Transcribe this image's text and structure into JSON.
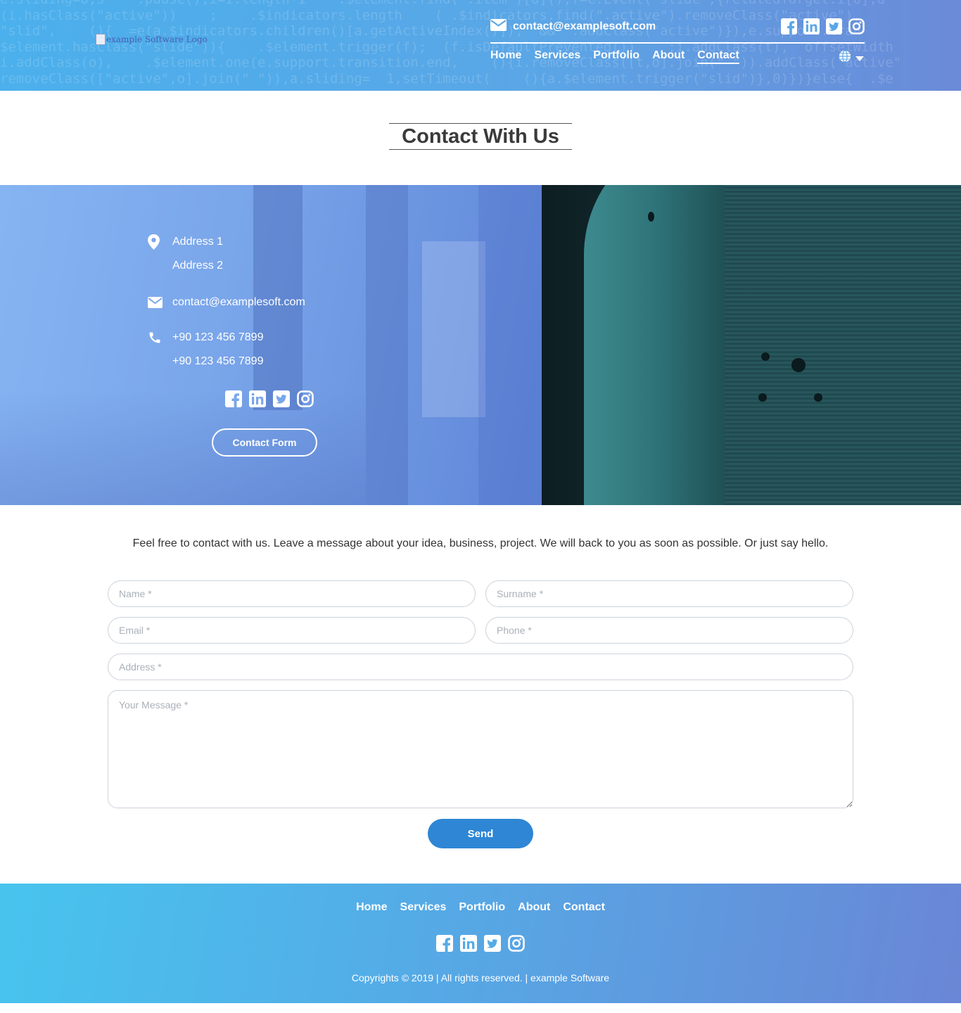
{
  "header": {
    "logo_alt": "example Software Logo",
    "email": "contact@examplesoft.com",
    "nav": [
      "Home",
      "Services",
      "Portfolio",
      "About",
      "Contact"
    ],
    "active_nav": "Contact",
    "social": [
      "facebook-icon",
      "linkedin-icon",
      "twitter-icon",
      "instagram-icon"
    ],
    "language_icon": "globe-icon"
  },
  "section": {
    "title": "Contact With Us"
  },
  "contact_info": {
    "address_line1": "Address 1",
    "address_line2": "Address 2",
    "email": "contact@examplesoft.com",
    "phone1": "+90 123 456 7899",
    "phone2": "+90 123 456 7899",
    "contact_form_button": "Contact Form"
  },
  "form": {
    "intro": "Feel free to contact with us. Leave a message about your idea, business, project. We will back to you as soon as possible. Or just say hello.",
    "name_placeholder": "Name *",
    "surname_placeholder": "Surname *",
    "email_placeholder": "Email *",
    "phone_placeholder": "Phone *",
    "address_placeholder": "Address *",
    "message_placeholder": "Your Message *",
    "send_label": "Send"
  },
  "footer": {
    "nav": [
      "Home",
      "Services",
      "Portfolio",
      "About",
      "Contact"
    ],
    "copyright": "Copyrights © 2019 | All rights reserved. | example Software"
  },
  "colors": {
    "header_gradient_start": "#4bb0ec",
    "header_gradient_end": "#6b8ad8",
    "send_button": "#2e86d4",
    "footer_gradient_start": "#47c4ee",
    "footer_gradient_end": "#6a86d6"
  }
}
